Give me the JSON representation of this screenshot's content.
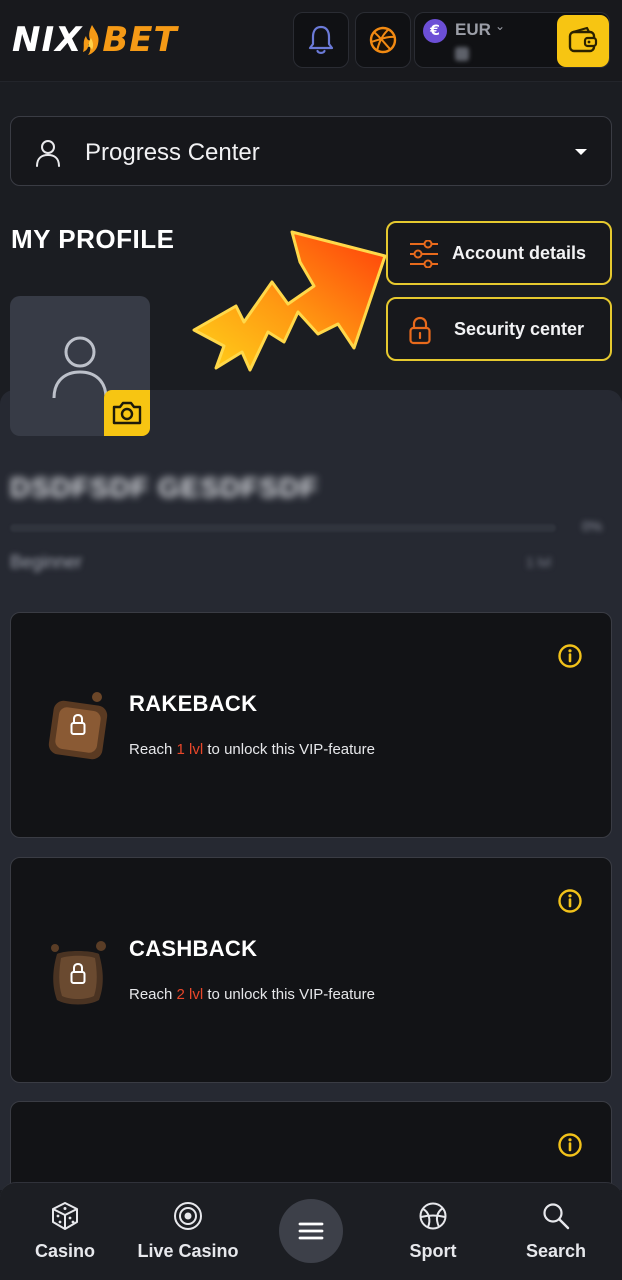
{
  "header": {
    "logo_left": "NIX",
    "logo_right": "BET",
    "currency": "EUR",
    "currency_symbol": "€"
  },
  "selector": {
    "label": "Progress Center"
  },
  "profile": {
    "section_title": "MY PROFILE",
    "account_details_label": "Account details",
    "security_center_label": "Security center",
    "user_name": "DSDFSDF GESDFSDF",
    "progress_percent": 0,
    "progress_text": "0%",
    "level_name": "Beginner",
    "level_text": "1 lvl"
  },
  "vip_cards": [
    {
      "title": "RAKEBACK",
      "desc_before": "Reach",
      "level": "1 lvl",
      "desc_after": "to unlock this VIP-feature"
    },
    {
      "title": "CASHBACK",
      "desc_before": "Reach",
      "level": "2 lvl",
      "desc_after": "to unlock this VIP-feature"
    }
  ],
  "bottom_nav": {
    "casino": "Casino",
    "live_casino": "Live Casino",
    "sport": "Sport",
    "search": "Search"
  },
  "colors": {
    "accent_yellow": "#f7c512",
    "accent_orange": "#f59a16",
    "level_red": "#e8472a",
    "background": "#1b1d22"
  }
}
